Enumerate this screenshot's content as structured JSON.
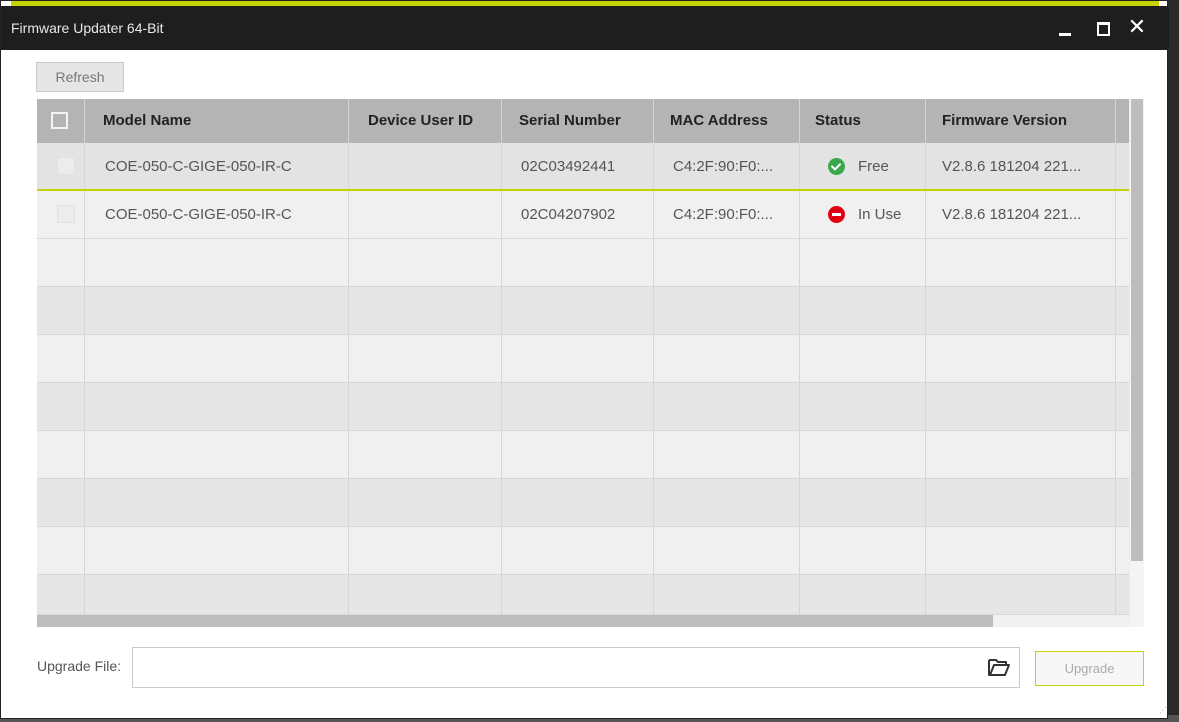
{
  "window": {
    "title": "Firmware Updater 64-Bit",
    "accent_color": "#c5d400"
  },
  "toolbar": {
    "refresh_label": "Refresh"
  },
  "table": {
    "columns": [
      "Model Name",
      "Device User ID",
      "Serial Number",
      "MAC Address",
      "Status",
      "Firmware Version"
    ],
    "rows": [
      {
        "model": "COE-050-C-GIGE-050-IR-C",
        "user_id": "",
        "serial": "02C03492441",
        "mac": "C4:2F:90:F0:...",
        "status": "Free",
        "status_icon": "check-circle-icon",
        "firmware": "V2.8.6 181204 221..."
      },
      {
        "model": "COE-050-C-GIGE-050-IR-C",
        "user_id": "",
        "serial": "02C04207902",
        "mac": "C4:2F:90:F0:...",
        "status": "In Use",
        "status_icon": "minus-circle-icon",
        "firmware": "V2.8.6 181204 221..."
      }
    ]
  },
  "footer": {
    "upgrade_file_label": "Upgrade File:",
    "upgrade_file_value": "",
    "upgrade_button": "Upgrade",
    "folder_icon": "folder-open-icon"
  },
  "status_colors": {
    "free": "#3aa84a",
    "in_use": "#e10012"
  }
}
